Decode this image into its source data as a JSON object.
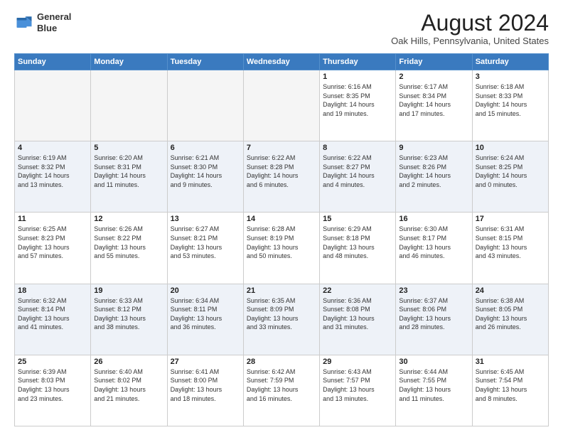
{
  "header": {
    "logo_line1": "General",
    "logo_line2": "Blue",
    "main_title": "August 2024",
    "subtitle": "Oak Hills, Pennsylvania, United States"
  },
  "weekdays": [
    "Sunday",
    "Monday",
    "Tuesday",
    "Wednesday",
    "Thursday",
    "Friday",
    "Saturday"
  ],
  "weeks": [
    [
      {
        "day": "",
        "info": ""
      },
      {
        "day": "",
        "info": ""
      },
      {
        "day": "",
        "info": ""
      },
      {
        "day": "",
        "info": ""
      },
      {
        "day": "1",
        "info": "Sunrise: 6:16 AM\nSunset: 8:35 PM\nDaylight: 14 hours\nand 19 minutes."
      },
      {
        "day": "2",
        "info": "Sunrise: 6:17 AM\nSunset: 8:34 PM\nDaylight: 14 hours\nand 17 minutes."
      },
      {
        "day": "3",
        "info": "Sunrise: 6:18 AM\nSunset: 8:33 PM\nDaylight: 14 hours\nand 15 minutes."
      }
    ],
    [
      {
        "day": "4",
        "info": "Sunrise: 6:19 AM\nSunset: 8:32 PM\nDaylight: 14 hours\nand 13 minutes."
      },
      {
        "day": "5",
        "info": "Sunrise: 6:20 AM\nSunset: 8:31 PM\nDaylight: 14 hours\nand 11 minutes."
      },
      {
        "day": "6",
        "info": "Sunrise: 6:21 AM\nSunset: 8:30 PM\nDaylight: 14 hours\nand 9 minutes."
      },
      {
        "day": "7",
        "info": "Sunrise: 6:22 AM\nSunset: 8:28 PM\nDaylight: 14 hours\nand 6 minutes."
      },
      {
        "day": "8",
        "info": "Sunrise: 6:22 AM\nSunset: 8:27 PM\nDaylight: 14 hours\nand 4 minutes."
      },
      {
        "day": "9",
        "info": "Sunrise: 6:23 AM\nSunset: 8:26 PM\nDaylight: 14 hours\nand 2 minutes."
      },
      {
        "day": "10",
        "info": "Sunrise: 6:24 AM\nSunset: 8:25 PM\nDaylight: 14 hours\nand 0 minutes."
      }
    ],
    [
      {
        "day": "11",
        "info": "Sunrise: 6:25 AM\nSunset: 8:23 PM\nDaylight: 13 hours\nand 57 minutes."
      },
      {
        "day": "12",
        "info": "Sunrise: 6:26 AM\nSunset: 8:22 PM\nDaylight: 13 hours\nand 55 minutes."
      },
      {
        "day": "13",
        "info": "Sunrise: 6:27 AM\nSunset: 8:21 PM\nDaylight: 13 hours\nand 53 minutes."
      },
      {
        "day": "14",
        "info": "Sunrise: 6:28 AM\nSunset: 8:19 PM\nDaylight: 13 hours\nand 50 minutes."
      },
      {
        "day": "15",
        "info": "Sunrise: 6:29 AM\nSunset: 8:18 PM\nDaylight: 13 hours\nand 48 minutes."
      },
      {
        "day": "16",
        "info": "Sunrise: 6:30 AM\nSunset: 8:17 PM\nDaylight: 13 hours\nand 46 minutes."
      },
      {
        "day": "17",
        "info": "Sunrise: 6:31 AM\nSunset: 8:15 PM\nDaylight: 13 hours\nand 43 minutes."
      }
    ],
    [
      {
        "day": "18",
        "info": "Sunrise: 6:32 AM\nSunset: 8:14 PM\nDaylight: 13 hours\nand 41 minutes."
      },
      {
        "day": "19",
        "info": "Sunrise: 6:33 AM\nSunset: 8:12 PM\nDaylight: 13 hours\nand 38 minutes."
      },
      {
        "day": "20",
        "info": "Sunrise: 6:34 AM\nSunset: 8:11 PM\nDaylight: 13 hours\nand 36 minutes."
      },
      {
        "day": "21",
        "info": "Sunrise: 6:35 AM\nSunset: 8:09 PM\nDaylight: 13 hours\nand 33 minutes."
      },
      {
        "day": "22",
        "info": "Sunrise: 6:36 AM\nSunset: 8:08 PM\nDaylight: 13 hours\nand 31 minutes."
      },
      {
        "day": "23",
        "info": "Sunrise: 6:37 AM\nSunset: 8:06 PM\nDaylight: 13 hours\nand 28 minutes."
      },
      {
        "day": "24",
        "info": "Sunrise: 6:38 AM\nSunset: 8:05 PM\nDaylight: 13 hours\nand 26 minutes."
      }
    ],
    [
      {
        "day": "25",
        "info": "Sunrise: 6:39 AM\nSunset: 8:03 PM\nDaylight: 13 hours\nand 23 minutes."
      },
      {
        "day": "26",
        "info": "Sunrise: 6:40 AM\nSunset: 8:02 PM\nDaylight: 13 hours\nand 21 minutes."
      },
      {
        "day": "27",
        "info": "Sunrise: 6:41 AM\nSunset: 8:00 PM\nDaylight: 13 hours\nand 18 minutes."
      },
      {
        "day": "28",
        "info": "Sunrise: 6:42 AM\nSunset: 7:59 PM\nDaylight: 13 hours\nand 16 minutes."
      },
      {
        "day": "29",
        "info": "Sunrise: 6:43 AM\nSunset: 7:57 PM\nDaylight: 13 hours\nand 13 minutes."
      },
      {
        "day": "30",
        "info": "Sunrise: 6:44 AM\nSunset: 7:55 PM\nDaylight: 13 hours\nand 11 minutes."
      },
      {
        "day": "31",
        "info": "Sunrise: 6:45 AM\nSunset: 7:54 PM\nDaylight: 13 hours\nand 8 minutes."
      }
    ]
  ]
}
